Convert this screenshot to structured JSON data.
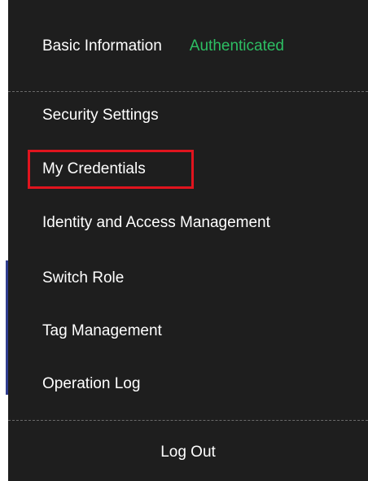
{
  "header": {
    "basic_info_label": "Basic Information",
    "auth_status": "Authenticated"
  },
  "menu": {
    "items": [
      {
        "label": "Security Settings"
      },
      {
        "label": "My Credentials",
        "highlighted": true
      },
      {
        "label": "Identity and Access Management"
      },
      {
        "label": "Switch Role"
      },
      {
        "label": "Tag Management"
      },
      {
        "label": "Operation Log"
      }
    ],
    "logout_label": "Log Out"
  },
  "colors": {
    "menu_background": "#1e1e1e",
    "authenticated_green": "#2dbf63",
    "highlight_red": "#e0141e",
    "divider_gray": "#6a6a6a",
    "edge_accent_blue": "#2f3d8f"
  }
}
